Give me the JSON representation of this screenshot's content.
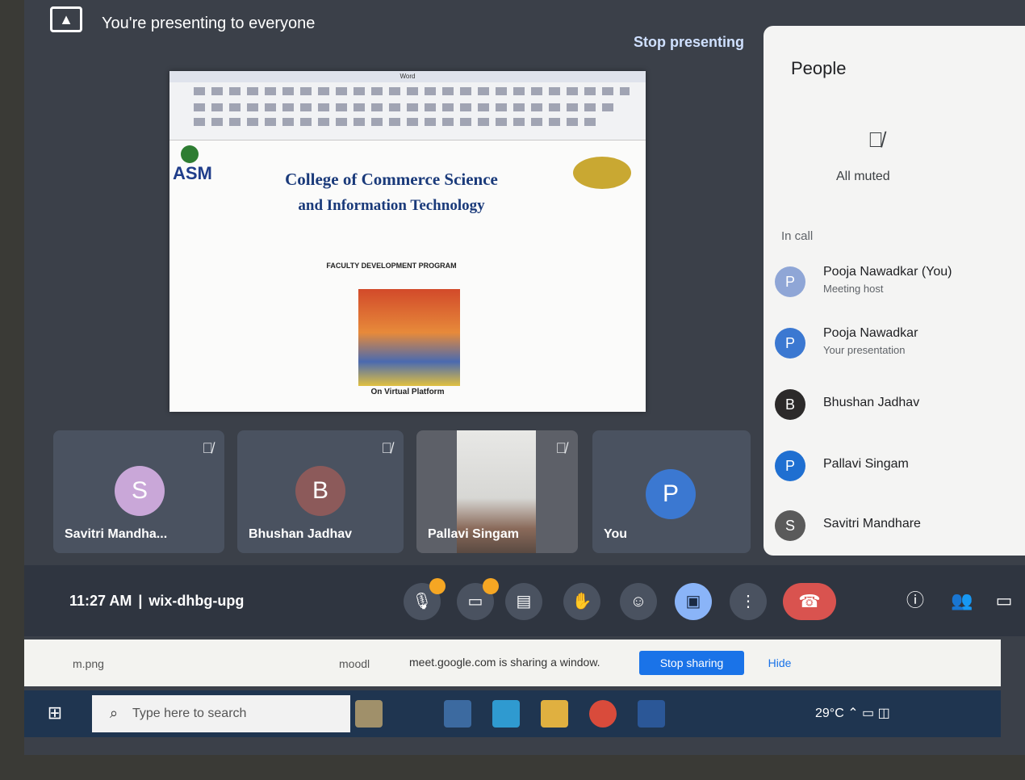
{
  "presenting": {
    "message": "You're presenting to everyone",
    "stop_label": "Stop presenting",
    "icon": "present-screen-icon"
  },
  "shared_document": {
    "window_title": "Word",
    "society": "",
    "title_line1": "College of Commerce Science",
    "title_line2": "and Information Technology",
    "subtitle": "",
    "program_heading": "FACULTY DEVELOPMENT PROGRAM",
    "poster_text": "",
    "poster_footer": "",
    "platform_text": "On Virtual Platform",
    "logo_text": "ASM"
  },
  "people_panel": {
    "title": "People",
    "muted_icon": "mic-off-icon",
    "all_muted_label": "All muted",
    "in_call_label": "In call",
    "participants": [
      {
        "initial": "P",
        "name": "Pooja Nawadkar (You)",
        "sub": "Meeting host",
        "color": "#8fa6d6"
      },
      {
        "initial": "P",
        "name": "Pooja Nawadkar",
        "sub": "Your presentation",
        "color": "#3b78d1"
      },
      {
        "initial": "B",
        "name": "Bhushan Jadhav",
        "sub": "",
        "color": "#2c2a2a"
      },
      {
        "initial": "P",
        "name": "Pallavi Singam",
        "sub": "",
        "color": "#1f6fd1"
      },
      {
        "initial": "S",
        "name": "Savitri Mandhare",
        "sub": "",
        "color": "#5a5a5a"
      }
    ]
  },
  "tiles": [
    {
      "initial": "S",
      "name": "Savitri Mandha...",
      "color": "#c9a7d8"
    },
    {
      "initial": "B",
      "name": "Bhushan Jadhav",
      "color": "#8c5a5a"
    },
    {
      "initial": "",
      "name": "Pallavi Singam",
      "color": "#6b6b6b"
    },
    {
      "initial": "P",
      "name": "You",
      "color": "#3b78d1"
    }
  ],
  "control_bar": {
    "time": "11:27 AM",
    "separator": "|",
    "meeting_code": "wix-dhbg-upg",
    "buttons": [
      "mic-icon",
      "camera-icon",
      "captions-icon",
      "raise-hand-icon",
      "emoji-icon",
      "present-icon",
      "more-options-icon"
    ],
    "end_call_icon": "end-call-icon",
    "right_buttons": [
      "info-icon",
      "people-icon",
      "chat-icon"
    ]
  },
  "share_notification": {
    "download_1": "m.png",
    "download_2": "moodl",
    "message": "meet.google.com is sharing a window.",
    "stop_sharing_label": "Stop sharing",
    "hide_label": "Hide"
  },
  "taskbar": {
    "search_placeholder": "Type here to search",
    "temperature": "29°C",
    "start_icon": "windows-start-icon"
  },
  "colors": {
    "meet_background": "#3b4049",
    "end_call_red": "#d9534f",
    "accent_blue": "#1a73e8",
    "badge_orange": "#f5a623"
  }
}
